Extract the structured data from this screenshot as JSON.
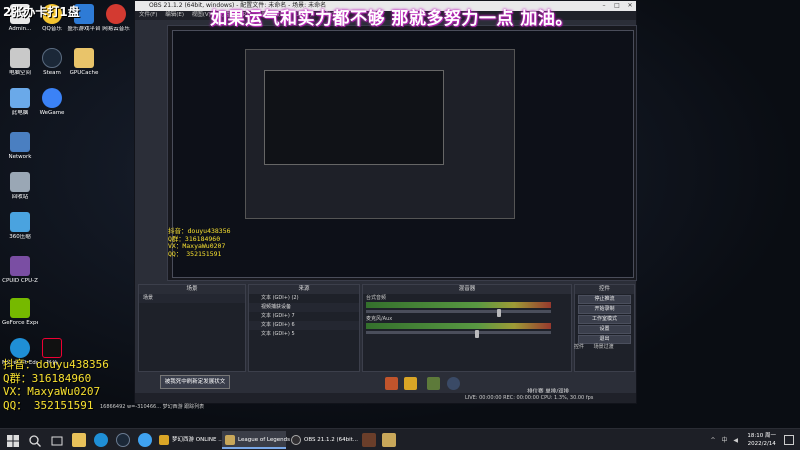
{
  "overlay": {
    "banner": "如果运气和实力都不够 那就多努力一点 加油。",
    "top_left_text": "2张办卡打1盘",
    "contact_lines": [
      "抖音：douyu438356",
      "Q群：316184960",
      "VX：MaxyaWu0207",
      "QQ： 352151591"
    ]
  },
  "desktop": {
    "icons": [
      {
        "label": "Admin...",
        "color": "#e8e8e8"
      },
      {
        "label": "QQ音乐",
        "color": "#f4c430"
      },
      {
        "label": "盛乐游戏平台",
        "color": "#2e7bd6"
      },
      {
        "label": "网易云音乐",
        "color": "#d33a31"
      },
      {
        "label": "电脑空间",
        "color": "#c9c9c9"
      },
      {
        "label": "Steam",
        "color": "#1b2838"
      },
      {
        "label": "GPUCache",
        "color": "#e9c46a"
      },
      {
        "label": "此电脑",
        "color": "#6aa9e9"
      },
      {
        "label": "WeGame",
        "color": "#3b82f6"
      },
      {
        "label": "Network",
        "color": "#4a7fc1"
      },
      {
        "label": "回收站",
        "color": "#9aa7b5"
      },
      {
        "label": "360压缩",
        "color": "#4aa3df"
      },
      {
        "label": "CPUID CPU-Z",
        "color": "#7a4ea3"
      },
      {
        "label": "GeForce Experience",
        "color": "#76b900"
      },
      {
        "label": "Microsoft Edge",
        "color": "#1f8fd6"
      },
      {
        "label": "抖音",
        "color": "#111111"
      }
    ]
  },
  "obs": {
    "title": "OBS 21.1.2 (64bit, windows) - 配置文件: 未命名 - 场景: 未命名",
    "menu": [
      "文件(F)",
      "编辑(E)",
      "视图(V)",
      "配置文件(P)",
      "场景集合(S)",
      "工具(T)",
      "帮助(H)"
    ],
    "panels": {
      "scenes": "场景",
      "sources": "来源",
      "mixer": "混音器",
      "controls": "控件"
    },
    "scene_item": "场景",
    "sources": [
      "文本 (GDI+) (2)",
      "视频捕获设备",
      "文本 (GDI+) 7",
      "文本 (GDI+) 6",
      "文本 (GDI+) 5"
    ],
    "mixer_tracks": [
      {
        "name": "台式音频",
        "level": 0.72
      },
      {
        "name": "麦克风/Aux",
        "level": 0.6
      }
    ],
    "controls": [
      "停止推流",
      "开始录制",
      "工作室模式",
      "设置",
      "退出"
    ],
    "status": "LIVE: 00:00:00    REC: 00:00:00    CPU: 1.3%, 30.00 fps",
    "overlay_toolbar": "被我死中刷新定发展状文",
    "tab_labels": [
      "控件",
      "场景过渡"
    ],
    "bottom_text": "排位赛 单排/双排",
    "bottom_numbers": "16866492    w=-310466...    梦幻西游    跟踪列表"
  },
  "taskbar": {
    "apps": [
      "梦幻西游 ONLINE ...",
      "League of Legends",
      "OBS 21.1.2 (64bit..."
    ],
    "time": "18:10 周一",
    "date": "2022/2/14",
    "tray": "^ 中 ◀"
  }
}
